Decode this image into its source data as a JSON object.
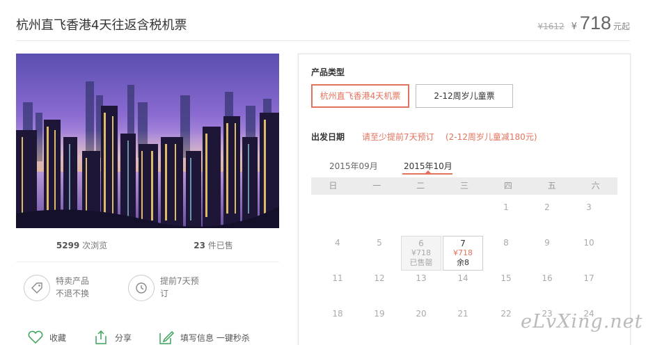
{
  "header": {
    "title": "杭州直飞香港4天往返含税机票",
    "original_price": "¥1612",
    "currency": "¥",
    "price": "718",
    "price_unit": "元起"
  },
  "stats": {
    "views_count": "5299",
    "views_label": "次浏览",
    "sold_count": "23",
    "sold_label": "件已售"
  },
  "features": [
    {
      "icon": "tag-icon",
      "line1": "特卖产品",
      "line2": "不退不换"
    },
    {
      "icon": "clock-icon",
      "line1": "提前7天预",
      "line2": "订"
    }
  ],
  "actions": {
    "favorite": "收藏",
    "share": "分享",
    "fill_info": "填写信息 一键秒杀"
  },
  "product_type": {
    "label": "产品类型",
    "options": [
      "杭州直飞香港4天机票",
      "2-12周岁儿童票"
    ],
    "selected": 0
  },
  "departure": {
    "label": "出发日期",
    "note": "请至少提前7天预订",
    "child_note": "(2-12周岁儿童减180元)"
  },
  "calendar": {
    "months": [
      "2015年09月",
      "2015年10月"
    ],
    "active_month": 1,
    "weekdays": [
      "日",
      "一",
      "二",
      "三",
      "四",
      "五",
      "六"
    ],
    "days": {
      "d1": "1",
      "d2": "2",
      "d3": "3",
      "d4": "4",
      "d5": "5",
      "d6": "6",
      "d7": "7",
      "d8": "8",
      "d9": "9",
      "d10": "10",
      "d11": "11",
      "d12": "12",
      "d13": "13",
      "d14": "14",
      "d15": "15",
      "d16": "16",
      "d17": "17",
      "d18": "18",
      "d19": "19",
      "d20": "20",
      "d21": "21",
      "d22": "22",
      "d23": "23",
      "d24": "24"
    },
    "day6": {
      "price": "¥718",
      "status": "已售罄"
    },
    "day7": {
      "price": "¥718",
      "status": "余8"
    }
  },
  "watermark": "eLvXing.net",
  "colors": {
    "accent": "#e3735e",
    "weekday_bar": "#ececec"
  }
}
